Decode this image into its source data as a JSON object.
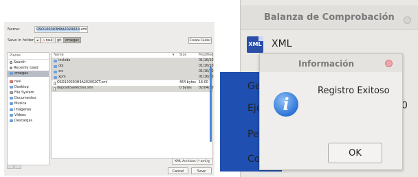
{
  "save_dialog": {
    "name_label": "Name:",
    "name_selected": "OSO100303H9A2020020",
    "name_ext": ".xml",
    "save_in_label": "Save in folder:",
    "breadcrumbs": [
      "◂",
      "raul",
      "git",
      "omegac"
    ],
    "create_folder": "Create Folder",
    "places_header": "Places",
    "places": [
      {
        "label": "Search",
        "icon": "search-icon"
      },
      {
        "label": "Recently Used",
        "icon": "recent-icon"
      },
      {
        "label": "omegac",
        "icon": "folder-icon",
        "selected": true
      },
      {
        "label": "raul",
        "icon": "home-icon",
        "gap": true
      },
      {
        "label": "Desktop",
        "icon": "folder-icon"
      },
      {
        "label": "File System",
        "icon": "drive-icon"
      },
      {
        "label": "Documentos",
        "icon": "folder-icon"
      },
      {
        "label": "Música",
        "icon": "folder-icon"
      },
      {
        "label": "Imágenes",
        "icon": "folder-icon"
      },
      {
        "label": "Vídeos",
        "icon": "folder-icon"
      },
      {
        "label": "Descargas",
        "icon": "folder-icon"
      }
    ],
    "columns": {
      "name": "Name",
      "size": "Size",
      "modified": "Modified"
    },
    "files": [
      {
        "name": "include",
        "size": "",
        "modified": "01/16/20",
        "type": "folder",
        "sel": true
      },
      {
        "name": "obj",
        "size": "",
        "modified": "01/16/20",
        "type": "folder",
        "sel": true
      },
      {
        "name": "src",
        "size": "",
        "modified": "01/16/20",
        "type": "folder",
        "sel": true
      },
      {
        "name": "xpm",
        "size": "",
        "modified": "01/16/20",
        "type": "folder",
        "sel": true
      },
      {
        "name": "OSO100303H9A202002CT.xml",
        "size": "464 bytes",
        "modified": "16:00",
        "type": "doc",
        "sel": false
      },
      {
        "name": "depositosefectivo.xml",
        "size": "0 bytes",
        "modified": "02/04/20",
        "type": "doc",
        "sel": true
      }
    ],
    "filter": "XML Archivos (*.xml)",
    "cancel": "Cancel",
    "save": "Save"
  },
  "balanza": {
    "title": "Balanza de Comprobación",
    "logo_text": "XML",
    "subtitle": "XML",
    "labels": [
      "Ge",
      "Eje",
      "Pe",
      "Co"
    ],
    "value": "0"
  },
  "info_dialog": {
    "title": "Información",
    "message": "Registro Exitoso",
    "icon_glyph": "i",
    "ok": "OK"
  }
}
